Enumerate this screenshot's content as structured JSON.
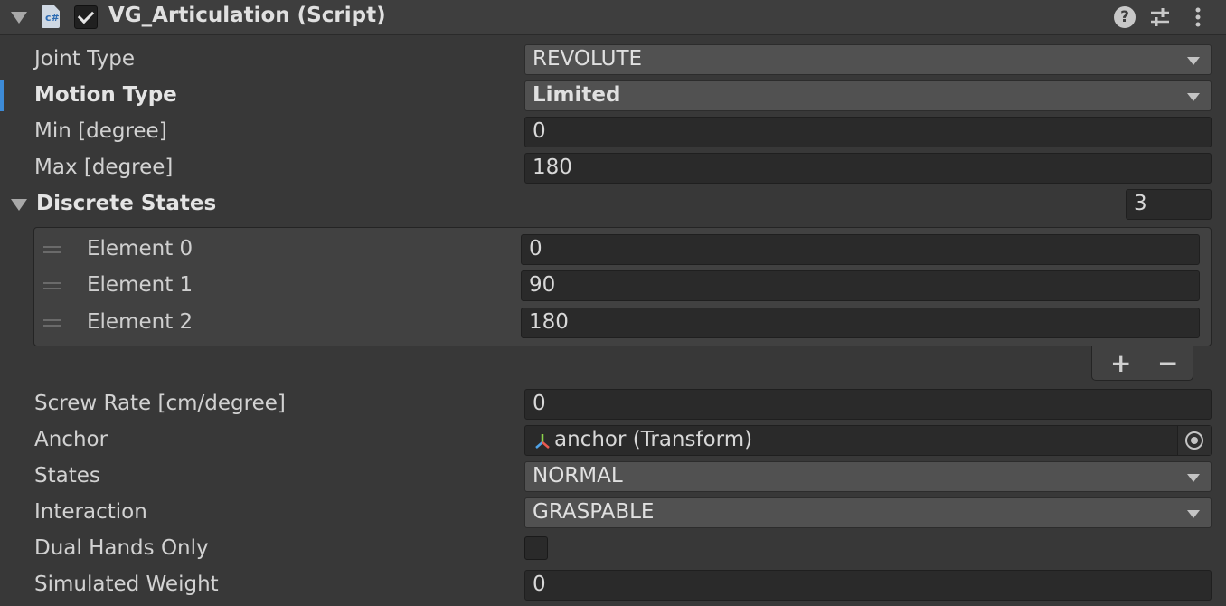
{
  "component": {
    "title": "VG_Articulation (Script)",
    "script_icon_text": "c#",
    "enabled": true,
    "help_icon": "?"
  },
  "fields": {
    "joint_type": {
      "label": "Joint Type",
      "value": "REVOLUTE"
    },
    "motion_type": {
      "label": "Motion Type",
      "value": "Limited"
    },
    "min_degree": {
      "label": "Min [degree]",
      "value": "0"
    },
    "max_degree": {
      "label": "Max [degree]",
      "value": "180"
    },
    "discrete_states": {
      "label": "Discrete States",
      "size": "3",
      "elements": [
        {
          "label": "Element 0",
          "value": "0"
        },
        {
          "label": "Element 1",
          "value": "90"
        },
        {
          "label": "Element 2",
          "value": "180"
        }
      ],
      "add_label": "+",
      "remove_label": "−"
    },
    "screw_rate": {
      "label": "Screw Rate [cm/degree]",
      "value": "0"
    },
    "anchor": {
      "label": "Anchor",
      "value": "anchor (Transform)"
    },
    "states": {
      "label": "States",
      "value": "NORMAL"
    },
    "interaction": {
      "label": "Interaction",
      "value": "GRASPABLE"
    },
    "dual_hands_only": {
      "label": "Dual Hands Only",
      "checked": false
    },
    "simulated_weight": {
      "label": "Simulated Weight",
      "value": "0"
    }
  },
  "colors": {
    "background": "#383838",
    "header": "#3e3e3e",
    "selection_accent": "#3d8bd7",
    "field_bg": "#2a2a2a",
    "dropdown_bg": "#515151"
  }
}
